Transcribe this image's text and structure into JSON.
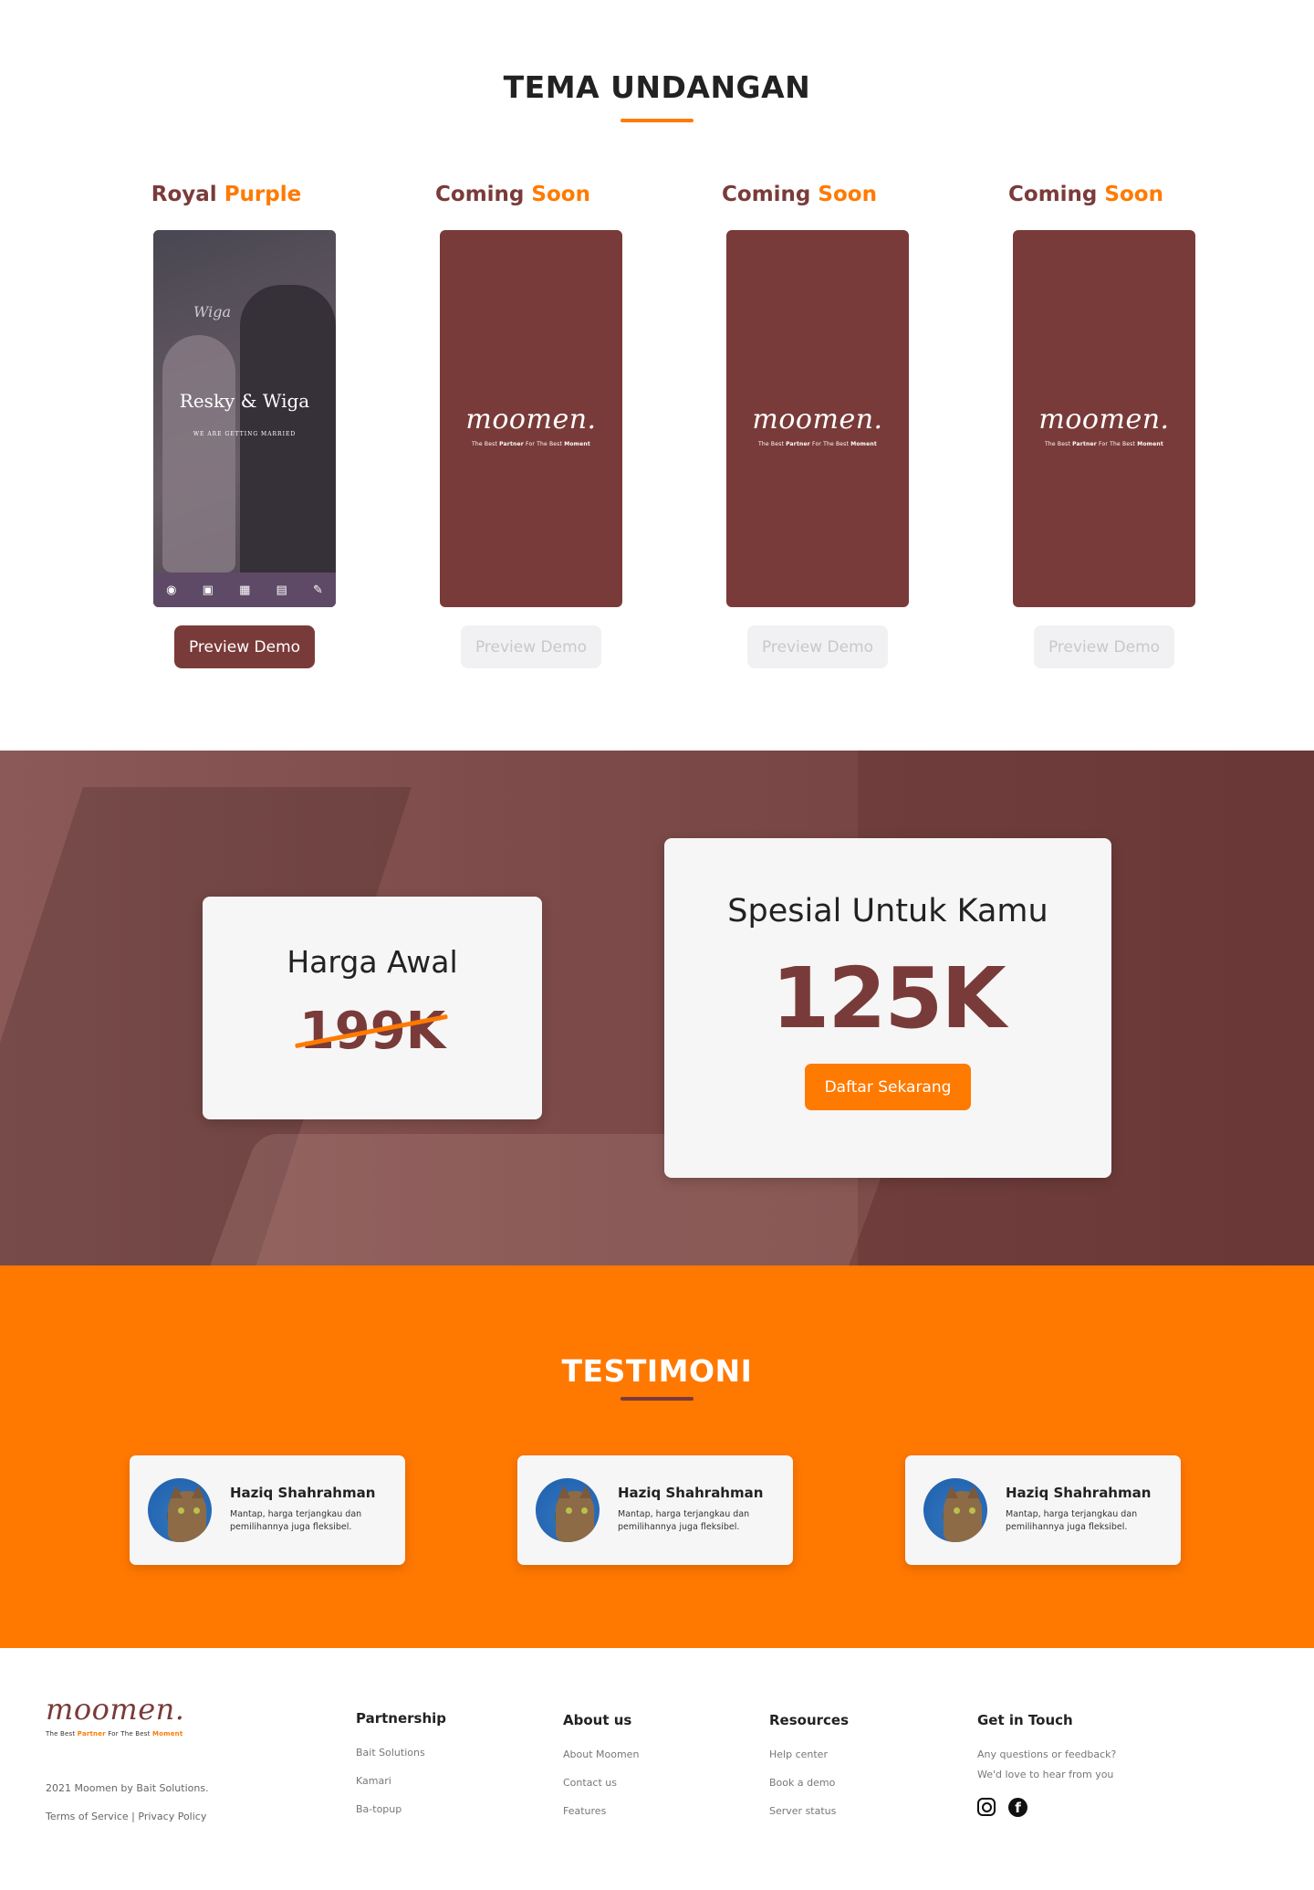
{
  "tema": {
    "title": "TEMA UNDANGAN",
    "themes": [
      {
        "name_a": "Royal",
        "name_b": "Purple",
        "button": "Preview Demo"
      },
      {
        "name_a": "Coming",
        "name_b": "Soon",
        "button": "Preview Demo"
      },
      {
        "name_a": "Coming",
        "name_b": "Soon",
        "button": "Preview Demo"
      },
      {
        "name_a": "Coming",
        "name_b": "Soon",
        "button": "Preview Demo"
      }
    ],
    "royal_preview": {
      "names": "Resky & Wiga",
      "subtitle": "WE ARE GETTING MARRIED",
      "script_text": "Wiga",
      "nav_icons": [
        "ring-icon",
        "gallery-icon",
        "calendar-icon",
        "gift-icon",
        "rsvp-icon"
      ]
    },
    "logo": {
      "word": "moomen.",
      "tag_a": "The Best",
      "tag_b": "Partner",
      "tag_c": "For The Best",
      "tag_d": "Moment"
    }
  },
  "pricing": {
    "old_label": "Harga Awal",
    "old_price": "199K",
    "new_label": "Spesial Untuk Kamu",
    "new_price": "125K",
    "cta": "Daftar Sekarang"
  },
  "testimoni": {
    "title": "TESTIMONI",
    "items": [
      {
        "name": "Haziq Shahrahman",
        "text": "Mantap, harga terjangkau dan pemilihannya juga fleksibel."
      },
      {
        "name": "Haziq Shahrahman",
        "text": "Mantap, harga terjangkau dan pemilihannya juga fleksibel."
      },
      {
        "name": "Haziq Shahrahman",
        "text": "Mantap, harga terjangkau dan pemilihannya juga fleksibel."
      }
    ]
  },
  "footer": {
    "logo_word": "moomen.",
    "copyright": "2021 Moomen by Bait Solutions.",
    "terms": "Terms of Service",
    "separator": "|",
    "privacy": "Privacy Policy",
    "columns": [
      {
        "title": "Partnership",
        "items": [
          "Bait Solutions",
          "Kamari",
          "Ba-topup"
        ]
      },
      {
        "title": "About us",
        "items": [
          "About Moomen",
          "Contact us",
          "Features"
        ]
      },
      {
        "title": "Resources",
        "items": [
          "Help center",
          "Book a demo",
          "Server status"
        ]
      }
    ],
    "contact": {
      "title": "Get in Touch",
      "line1": "Any questions or feedback?",
      "line2": "We'd love to hear from you"
    },
    "social": [
      "instagram-icon",
      "facebook-icon"
    ]
  },
  "colors": {
    "brand": "#793b39",
    "accent": "#ff7a00",
    "disabled": "#f1f1f3"
  }
}
